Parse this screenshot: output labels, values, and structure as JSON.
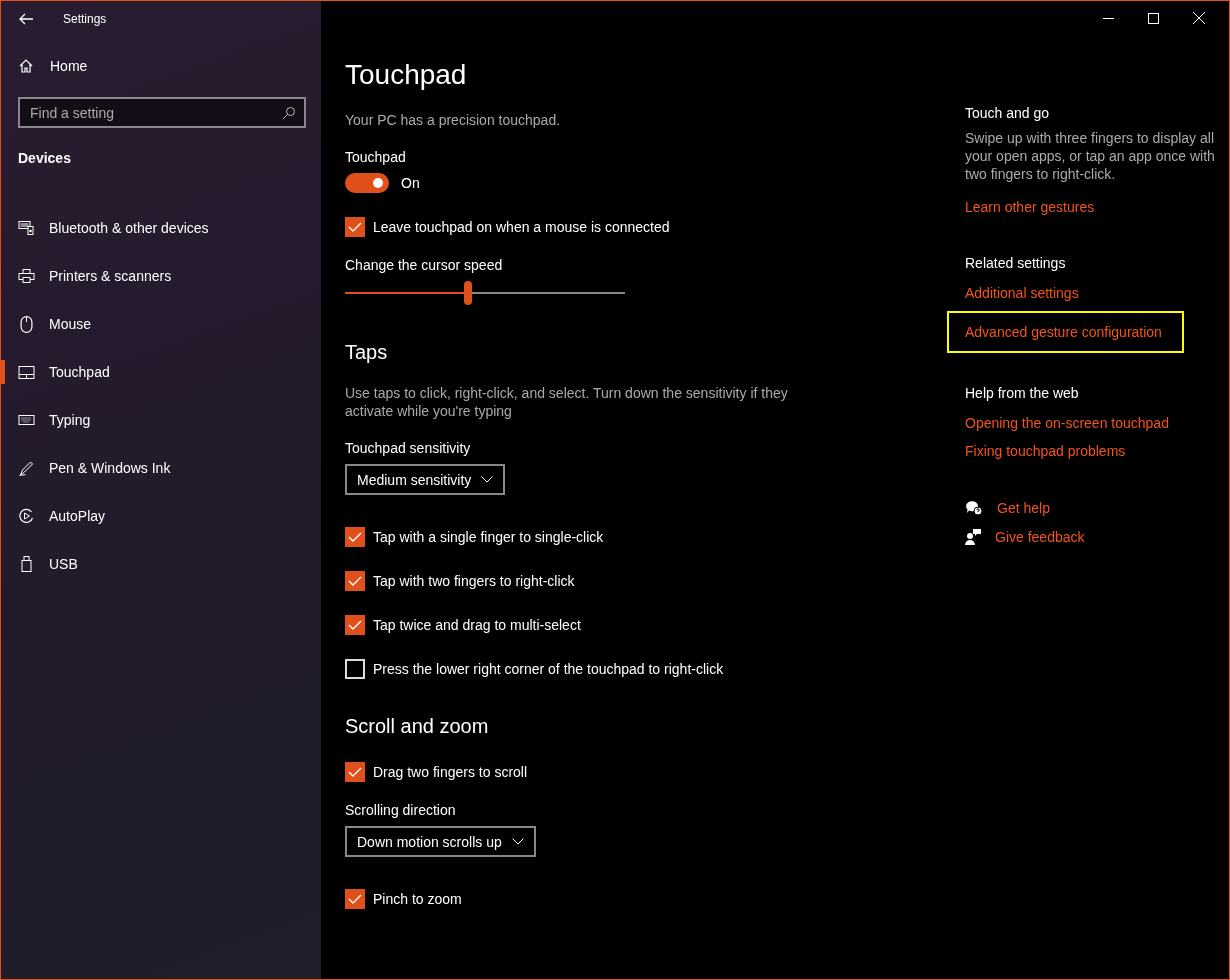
{
  "window": {
    "title": "Settings"
  },
  "sidebar": {
    "home": "Home",
    "search": {
      "placeholder": "Find a setting"
    },
    "section": "Devices",
    "items": [
      {
        "label": "Bluetooth & other devices",
        "kind": "devices",
        "selected": false
      },
      {
        "label": "Printers & scanners",
        "kind": "printer",
        "selected": false
      },
      {
        "label": "Mouse",
        "kind": "mouse",
        "selected": false
      },
      {
        "label": "Touchpad",
        "kind": "touchpad",
        "selected": true
      },
      {
        "label": "Typing",
        "kind": "keyboard",
        "selected": false
      },
      {
        "label": "Pen & Windows Ink",
        "kind": "pen",
        "selected": false
      },
      {
        "label": "AutoPlay",
        "kind": "autoplay",
        "selected": false
      },
      {
        "label": "USB",
        "kind": "usb",
        "selected": false
      }
    ]
  },
  "main": {
    "title": "Touchpad",
    "sections": [
      {
        "items": [
          {
            "kind": "text",
            "text": "Your PC has a precision touchpad."
          },
          {
            "kind": "toggle",
            "label": "Touchpad",
            "on": true,
            "state_text": "On"
          },
          {
            "kind": "checkbox",
            "label": "Leave touchpad on when a mouse is connected",
            "checked": true
          },
          {
            "kind": "slider",
            "label": "Change the cursor speed",
            "level": 0.44
          }
        ]
      },
      {
        "heading": "Taps",
        "items": [
          {
            "kind": "text",
            "text": "Use taps to click, right-click, and select. Turn down the sensitivity if they activate while you're typing"
          },
          {
            "kind": "dropdown",
            "label": "Touchpad sensitivity",
            "value": "Medium sensitivity"
          },
          {
            "kind": "checkbox",
            "label": "Tap with a single finger to single-click",
            "checked": true
          },
          {
            "kind": "checkbox",
            "label": "Tap with two fingers to right-click",
            "checked": true
          },
          {
            "kind": "checkbox",
            "label": "Tap twice and drag to multi-select",
            "checked": true
          },
          {
            "kind": "checkbox",
            "label": "Press the lower right corner of the touchpad to right-click",
            "checked": false
          }
        ]
      },
      {
        "heading": "Scroll and zoom",
        "items": [
          {
            "kind": "checkbox",
            "label": "Drag two fingers to scroll",
            "checked": true
          },
          {
            "kind": "dropdown",
            "label": "Scrolling direction",
            "value": "Down motion scrolls up"
          },
          {
            "kind": "checkbox",
            "label": "Pinch to zoom",
            "checked": true
          }
        ]
      }
    ]
  },
  "aside": {
    "groups": [
      {
        "heading": "Touch and go",
        "text": "Swipe up with three fingers to display all your open apps, or tap an app once with two fingers to right-click.",
        "links": [
          {
            "label": "Learn other gestures",
            "highlighted": false
          }
        ]
      },
      {
        "heading": "Related settings",
        "links": [
          {
            "label": "Additional settings",
            "highlighted": false
          },
          {
            "label": "Advanced gesture configuration",
            "highlighted": true
          }
        ]
      },
      {
        "heading": "Help from the web",
        "links": [
          {
            "label": "Opening the on-screen touchpad",
            "highlighted": false
          },
          {
            "label": "Fixing touchpad problems",
            "highlighted": false
          }
        ]
      }
    ],
    "help": [
      {
        "kind": "help",
        "label": "Get help"
      },
      {
        "kind": "feedback",
        "label": "Give feedback"
      }
    ]
  }
}
